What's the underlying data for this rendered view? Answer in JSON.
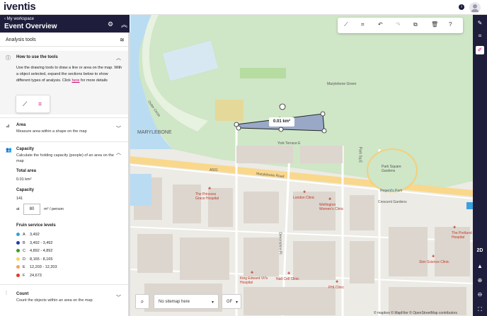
{
  "app": {
    "logo": "iventis",
    "info_icon": "i"
  },
  "header": {
    "back_label": "My workspace",
    "title": "Event Overview"
  },
  "tools_section": {
    "title": "Analysis tools"
  },
  "howto": {
    "title": "How to use the tools",
    "body_pre": "Use the drawing tools to draw a line or area on the map. With a object selected, expand the sections below to show different types of analysis. Click ",
    "link": "here",
    "body_post": " for more details"
  },
  "area": {
    "title": "Area",
    "subtitle": "Measure area within a shape on the map"
  },
  "capacity": {
    "title": "Capacity",
    "subtitle": "Calculate the holding capacity (people) of an area on the map",
    "total_area_label": "Total area",
    "total_area_value": "0.01 km²",
    "capacity_label": "Capacity",
    "capacity_value": "141",
    "at_label": "at",
    "density_value": "80",
    "density_unit": "m² / person",
    "levels_title": "Fruin service levels",
    "levels": [
      {
        "grade": "A",
        "range": "3,492",
        "color": "#3aa0e0"
      },
      {
        "grade": "B",
        "range": "3,492 - 3,492",
        "color": "#1f3fa8"
      },
      {
        "grade": "C",
        "range": "4,892 - 4,892",
        "color": "#3c9a2c"
      },
      {
        "grade": "D",
        "range": "8,165 - 8,165",
        "color": "#f6d468"
      },
      {
        "grade": "E",
        "range": "12,203 - 12,203",
        "color": "#f2a35a"
      },
      {
        "grade": "F",
        "range": "24,673",
        "color": "#e03b2d"
      }
    ]
  },
  "count": {
    "title": "Count",
    "subtitle": "Count the objects within an area on the map"
  },
  "map": {
    "shape_label": "0.01 km²",
    "sitemap_placeholder": "No sitemap here",
    "level": "GF",
    "view_mode": "2D",
    "attribution": "© mapbox  © MapFiler © OpenStreetMap contributors",
    "labels": [
      "MARYLEBONE",
      "Marylebone Green",
      "Outer Circle",
      "York Terrace E",
      "Marylebone Road",
      "Park Square Gardens",
      "Regent's Park",
      "Crescent Gardens",
      "The Princess Grace Hospital",
      "London Clinic",
      "Wellington Women's Clinic",
      "The Portland Hospital",
      "Skin Science Clinic",
      "King Edward VII's Hospital",
      "Nad Cell Clinic",
      "PHI Clinic",
      "Devonshire Pl",
      "A501",
      "Park Sq E"
    ]
  }
}
